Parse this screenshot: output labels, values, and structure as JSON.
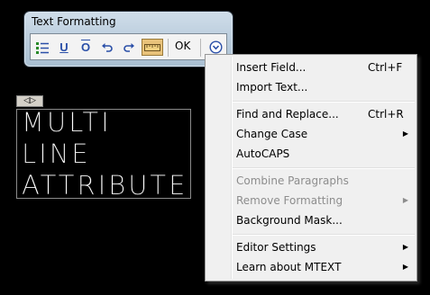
{
  "toolbar": {
    "title": "Text Formatting",
    "ok_label": "OK",
    "buttons": [
      {
        "icon": "numbering-icon"
      },
      {
        "icon": "underline-icon",
        "glyph": "U"
      },
      {
        "icon": "overline-icon",
        "glyph": "O"
      },
      {
        "icon": "undo-icon"
      },
      {
        "icon": "redo-icon"
      },
      {
        "icon": "ruler-icon",
        "active": true
      },
      {
        "icon": "options-icon"
      }
    ]
  },
  "editor": {
    "ruler_tab": "◁▷",
    "lines": [
      "MULTI",
      "LINE",
      "ATTRIBUTE"
    ]
  },
  "context_menu": {
    "items": [
      {
        "label": "Insert Field...",
        "shortcut": "Ctrl+F",
        "submenu": false,
        "disabled": false
      },
      {
        "label": "Import Text...",
        "shortcut": "",
        "submenu": false,
        "disabled": false
      },
      {
        "label": "Find and Replace...",
        "shortcut": "Ctrl+R",
        "submenu": false,
        "disabled": false
      },
      {
        "label": "Change Case",
        "shortcut": "",
        "submenu": true,
        "disabled": false
      },
      {
        "label": "AutoCAPS",
        "shortcut": "",
        "submenu": false,
        "disabled": false
      },
      {
        "label": "Combine Paragraphs",
        "shortcut": "",
        "submenu": false,
        "disabled": true
      },
      {
        "label": "Remove Formatting",
        "shortcut": "",
        "submenu": true,
        "disabled": true
      },
      {
        "label": "Background Mask...",
        "shortcut": "",
        "submenu": false,
        "disabled": false
      },
      {
        "label": "Editor Settings",
        "shortcut": "",
        "submenu": true,
        "disabled": false
      },
      {
        "label": "Learn about MTEXT",
        "shortcut": "",
        "submenu": true,
        "disabled": false
      }
    ],
    "submenu_arrow": "▶"
  },
  "colors": {
    "background": "#000000",
    "menu_bg": "#f0f0f0",
    "disabled_text": "#8d8d8d",
    "active_button": "#e8c27a",
    "accent_blue": "#2a4fa8"
  }
}
